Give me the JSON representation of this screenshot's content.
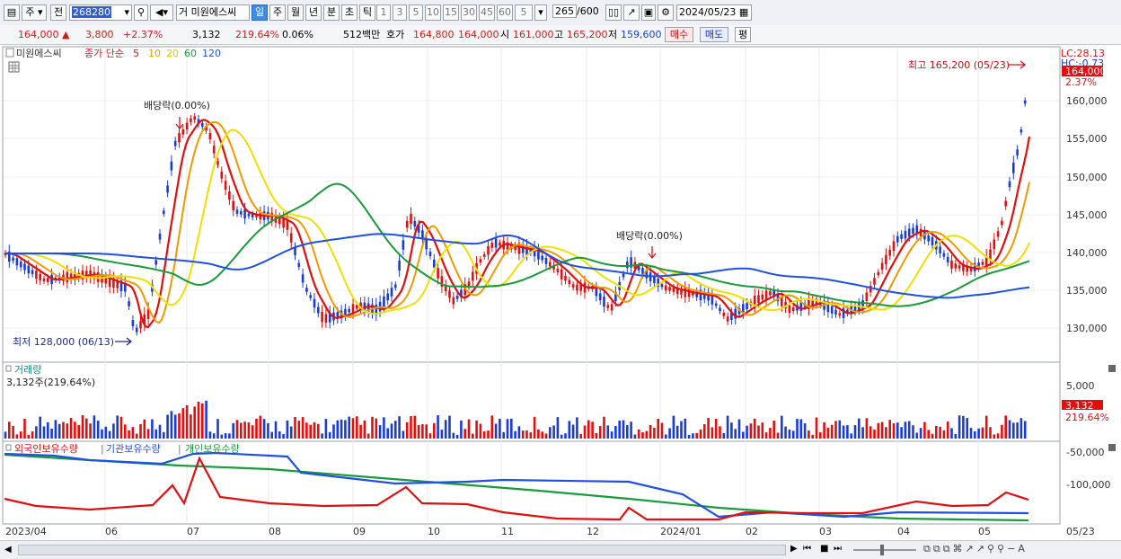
{
  "toolbar": {
    "period_type": "주",
    "prev_label": "전",
    "stock_code": "268280",
    "stock_name": "미원에스씨",
    "stock_name_prefix": "거",
    "periods": [
      "일",
      "주",
      "월",
      "년",
      "분",
      "초",
      "틱"
    ],
    "active_period": "일",
    "intervals": [
      "1",
      "3",
      "5",
      "10",
      "15",
      "30",
      "45",
      "60"
    ],
    "interval_value": "5",
    "count": "265",
    "count_max": "/600",
    "date": "2024/05/23"
  },
  "quote": {
    "price": "164,000",
    "change": "3,800",
    "change_pct": "+2.37%",
    "volume": "3,132",
    "volume_ratio": "219.64%",
    "turnover": "0.06%",
    "amount": "512백만",
    "bid_label": "호가",
    "bid": "164,800",
    "ask": "164,000",
    "open_label": "시",
    "open": "161,000",
    "high_label": "고",
    "high": "165,200",
    "low_label": "저",
    "low": "159,600",
    "buy_label": "매수",
    "sell_label": "매도",
    "avg_label": "평"
  },
  "price_panel": {
    "legend_name": "미원에스씨",
    "legend_ma_label": "종가 단순",
    "ma_periods": [
      "5",
      "10",
      "20",
      "60",
      "120"
    ],
    "ma_colors": [
      "#e01010",
      "#f0a000",
      "#f0e000",
      "#1a9a3a",
      "#2050e0"
    ],
    "lc_label": "LC:28.13",
    "hc_label": "HC:-0.73",
    "current_price_tag": "164,000",
    "current_pct_tag": "2.37%",
    "high_annotation": "최고 165,200 (05/23)",
    "low_annotation": "최저 128,000 (06/13)",
    "dividend_annotation_1": "배당락(0.00%)",
    "dividend_annotation_2": "배당락(0.00%)",
    "y_ticks": [
      "160,000",
      "155,000",
      "150,000",
      "145,000",
      "140,000",
      "135,000",
      "130,000"
    ]
  },
  "volume_panel": {
    "title": "거래량",
    "subtitle": "3,132주(219.64%)",
    "y_tick": "5,000",
    "value_tag": "3,132",
    "pct_tag": "219.64%"
  },
  "holdings_panel": {
    "titles": [
      "외국인보유수량",
      "기관보유수량",
      "개인보유수량"
    ],
    "colors": [
      "#e01010",
      "#2050e0",
      "#1a9a3a"
    ],
    "y_ticks": [
      "-50,000",
      "-100,000"
    ]
  },
  "x_axis": [
    "2023/04",
    "06",
    "07",
    "08",
    "09",
    "10",
    "11",
    "12",
    "2024/01",
    "02",
    "03",
    "04",
    "05",
    "05/23"
  ]
}
